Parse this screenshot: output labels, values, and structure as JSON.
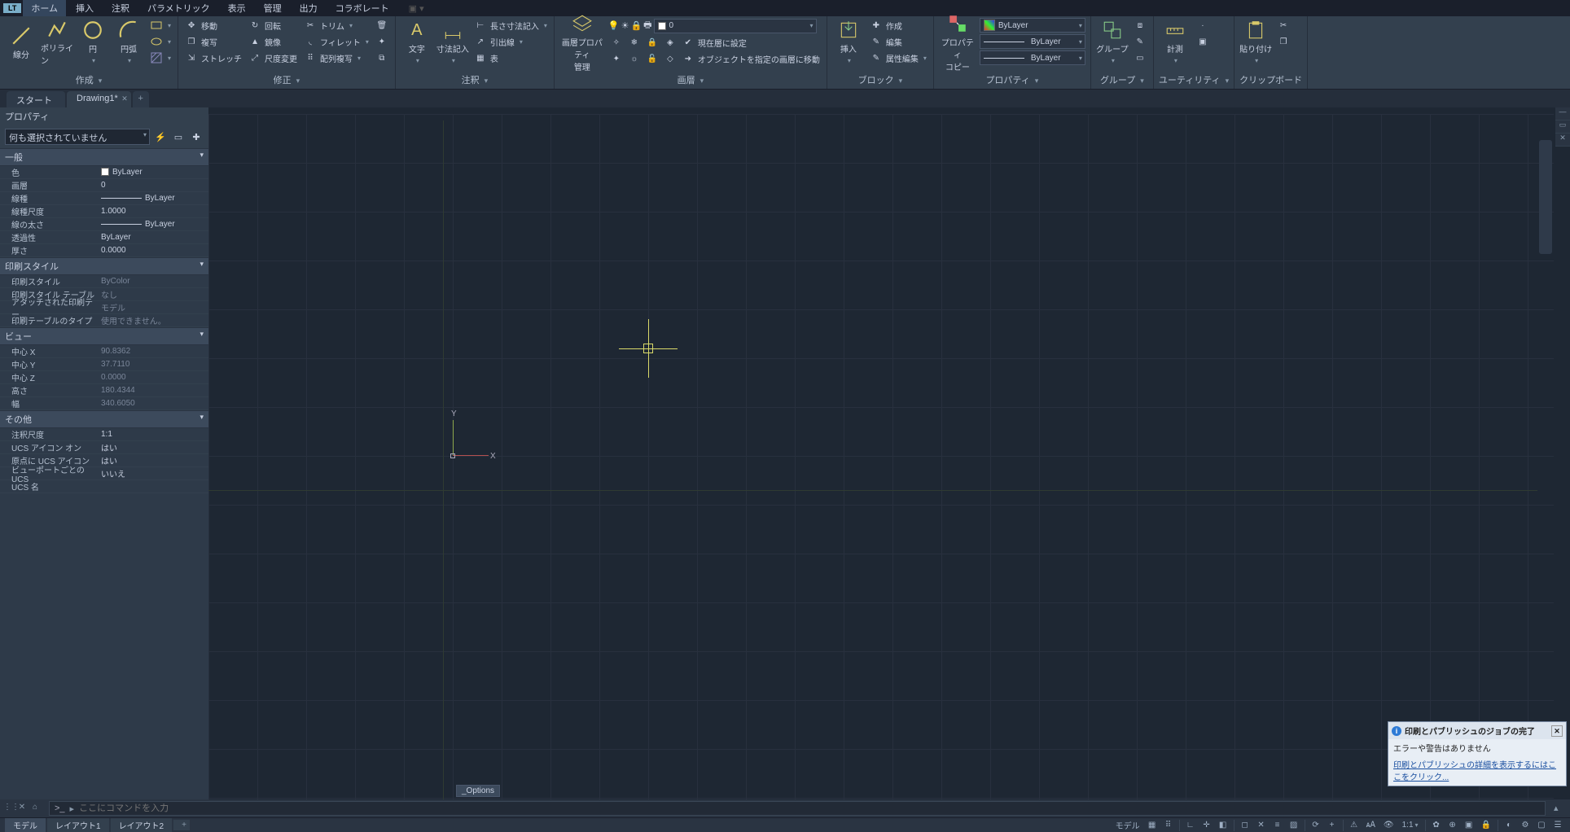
{
  "app": {
    "lt_badge": "LT"
  },
  "menu": {
    "items": [
      "ホーム",
      "挿入",
      "注釈",
      "パラメトリック",
      "表示",
      "管理",
      "出力",
      "コラボレート"
    ],
    "active_index": 0
  },
  "ribbon": {
    "panels": {
      "draw": {
        "title": "作成",
        "line": "線分",
        "polyline": "ポリライン",
        "circle": "円",
        "arc": "円弧"
      },
      "modify": {
        "title": "修正",
        "move": "移動",
        "copy": "複写",
        "stretch": "ストレッチ",
        "rotate": "回転",
        "mirror": "鏡像",
        "scale": "尺度変更",
        "trim": "トリム",
        "fillet": "フィレット",
        "array": "配列複写"
      },
      "annotation": {
        "title": "注釈",
        "text": "文字",
        "dimension": "寸法記入",
        "linear": "長さ寸法記入",
        "leader": "引出線",
        "table": "表"
      },
      "layers": {
        "title": "画層",
        "properties": "画層プロパティ\n管理",
        "combo_value": "0",
        "set_current": "現在層に設定",
        "move_to_layer": "オブジェクトを指定の画層に移動"
      },
      "block": {
        "title": "ブロック",
        "insert": "挿入",
        "create": "作成",
        "edit": "編集",
        "attr_edit": "属性編集"
      },
      "properties": {
        "title": "プロパティ",
        "copy": "プロパティ\nコピー",
        "color": "ByLayer",
        "linetype": "ByLayer",
        "lineweight": "ByLayer"
      },
      "group": {
        "title": "グループ",
        "label": "グループ"
      },
      "utility": {
        "title": "ユーティリティ",
        "measure": "計測"
      },
      "clipboard": {
        "title": "クリップボード",
        "paste": "貼り付け"
      }
    }
  },
  "doc_tabs": {
    "items": [
      {
        "label": "スタート",
        "active": false,
        "closable": false
      },
      {
        "label": "Drawing1*",
        "active": true,
        "closable": true
      }
    ]
  },
  "properties_panel": {
    "title": "プロパティ",
    "selector": "何も選択されていません",
    "sections": {
      "general": {
        "title": "一般",
        "rows": {
          "color": {
            "k": "色",
            "v": "ByLayer"
          },
          "layer": {
            "k": "画層",
            "v": "0"
          },
          "linetype": {
            "k": "線種",
            "v": "ByLayer"
          },
          "ltscale": {
            "k": "線種尺度",
            "v": "1.0000"
          },
          "lineweight": {
            "k": "線の太さ",
            "v": "ByLayer"
          },
          "transparency": {
            "k": "透過性",
            "v": "ByLayer"
          },
          "thickness": {
            "k": "厚さ",
            "v": "0.0000"
          }
        }
      },
      "plotstyle": {
        "title": "印刷スタイル",
        "rows": {
          "ps": {
            "k": "印刷スタイル",
            "v": "ByColor"
          },
          "pst": {
            "k": "印刷スタイル テーブル",
            "v": "なし"
          },
          "attached": {
            "k": "アタッチされた印刷テー...",
            "v": "モデル"
          },
          "tabletype": {
            "k": "印刷テーブルのタイプ",
            "v": "使用できません。"
          }
        }
      },
      "view": {
        "title": "ビュー",
        "rows": {
          "cx": {
            "k": "中心 X",
            "v": "90.8362"
          },
          "cy": {
            "k": "中心 Y",
            "v": "37.7110"
          },
          "cz": {
            "k": "中心 Z",
            "v": "0.0000"
          },
          "h": {
            "k": "高さ",
            "v": "180.4344"
          },
          "w": {
            "k": "幅",
            "v": "340.6050"
          }
        }
      },
      "other": {
        "title": "その他",
        "rows": {
          "annoscale": {
            "k": "注釈尺度",
            "v": "1:1"
          },
          "ucsicon_on": {
            "k": "UCS アイコン オン",
            "v": "はい"
          },
          "ucs_origin": {
            "k": "原点に UCS アイコン",
            "v": "はい"
          },
          "ucs_per_vp": {
            "k": "ビューポートごとの UCS",
            "v": "いいえ"
          },
          "ucs_name": {
            "k": "UCS 名",
            "v": ""
          }
        }
      }
    }
  },
  "drawing": {
    "ucs": {
      "y_label": "Y",
      "x_label": "X"
    },
    "cmd_tag": "_Options"
  },
  "commandline": {
    "placeholder": "ここにコマンドを入力",
    "prompt_icon": ">_"
  },
  "bottom_tabs": {
    "items": [
      "モデル",
      "レイアウト1",
      "レイアウト2"
    ],
    "active_index": 0
  },
  "status_bar": {
    "model": "モデル",
    "scale": "1:1"
  },
  "toast": {
    "title": "印刷とパブリッシュのジョブの完了",
    "body": "エラーや警告はありません",
    "link": "印刷とパブリッシュの詳細を表示するにはここをクリック..."
  }
}
